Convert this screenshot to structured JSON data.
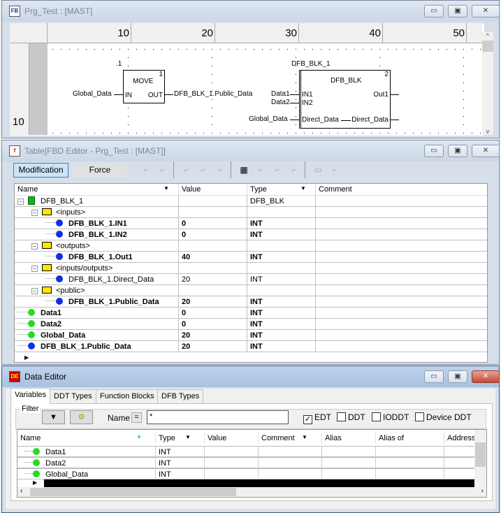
{
  "fbd_window": {
    "title": "Prg_Test : [MAST]",
    "icon": "fbd-icon",
    "ruler": [
      "10",
      "20",
      "30",
      "40",
      "50"
    ],
    "row_number": "10",
    "move_block": {
      "instance": ".1",
      "name": "MOVE",
      "number": "1",
      "in_pin": "IN",
      "out_pin": "OUT",
      "input_var": "Global_Data",
      "output_var": "DFB_BLK_1.Public_Data"
    },
    "dfb_block": {
      "instance": "DFB_BLK_1",
      "name": "DFB_BLK",
      "number": "2",
      "pins_in": [
        "IN1",
        "IN2",
        "Direct_Data"
      ],
      "pins_out": [
        "Out1",
        "Direct_Data"
      ],
      "vars_in": [
        "Data1",
        "Data2",
        "Global_Data"
      ]
    }
  },
  "table_window": {
    "title": "Table[FBD Editor - Prg_Test : [MAST]]",
    "modification_label": "Modification",
    "force_label": "Force",
    "columns": [
      "Name",
      "Value",
      "Type",
      "Comment"
    ],
    "rows": [
      {
        "level": 0,
        "icon": "dfb",
        "expand": "-",
        "name": "DFB_BLK_1",
        "value": "",
        "type": "DFB_BLK",
        "bold": false
      },
      {
        "level": 1,
        "icon": "folder",
        "expand": "-",
        "name": "<inputs>",
        "value": "",
        "type": "",
        "bold": false
      },
      {
        "level": 2,
        "icon": "blue",
        "name": "DFB_BLK_1.IN1",
        "value": "0",
        "type": "INT",
        "bold": true
      },
      {
        "level": 2,
        "icon": "blue",
        "name": "DFB_BLK_1.IN2",
        "value": "0",
        "type": "INT",
        "bold": true
      },
      {
        "level": 1,
        "icon": "folder",
        "expand": "-",
        "name": "<outputs>",
        "value": "",
        "type": "",
        "bold": false
      },
      {
        "level": 2,
        "icon": "blue",
        "name": "DFB_BLK_1.Out1",
        "value": "40",
        "type": "INT",
        "bold": true
      },
      {
        "level": 1,
        "icon": "folder",
        "expand": "-",
        "name": "<inputs/outputs>",
        "value": "",
        "type": "",
        "bold": false
      },
      {
        "level": 2,
        "icon": "blue",
        "name": "DFB_BLK_1.Direct_Data",
        "value": "20",
        "type": "INT",
        "bold": false
      },
      {
        "level": 1,
        "icon": "folder",
        "expand": "-",
        "name": "<public>",
        "value": "",
        "type": "",
        "bold": false
      },
      {
        "level": 2,
        "icon": "blue",
        "name": "DFB_BLK_1.Public_Data",
        "value": "20",
        "type": "INT",
        "bold": true
      },
      {
        "level": 0,
        "icon": "green",
        "name": "Data1",
        "value": "0",
        "type": "INT",
        "bold": true
      },
      {
        "level": 0,
        "icon": "green",
        "name": "Data2",
        "value": "0",
        "type": "INT",
        "bold": true
      },
      {
        "level": 0,
        "icon": "green",
        "name": "Global_Data",
        "value": "20",
        "type": "INT",
        "bold": true
      },
      {
        "level": 0,
        "icon": "blue",
        "name": "DFB_BLK_1.Public_Data",
        "value": "20",
        "type": "INT",
        "bold": true
      }
    ]
  },
  "data_editor": {
    "title": "Data Editor",
    "tabs": [
      "Variables",
      "DDT Types",
      "Function Blocks",
      "DFB Types"
    ],
    "filter": {
      "label": "Filter",
      "name_label": "Name",
      "eq_label": "=",
      "name_value": "*",
      "checkboxes": [
        {
          "label": "EDT",
          "checked": true
        },
        {
          "label": "DDT",
          "checked": false
        },
        {
          "label": "IODDT",
          "checked": false
        },
        {
          "label": "Device DDT",
          "checked": false
        }
      ]
    },
    "columns": [
      "Name",
      "Type",
      "Value",
      "Comment",
      "Alias",
      "Alias of",
      "Address"
    ],
    "rows": [
      {
        "name": "Data1",
        "type": "INT"
      },
      {
        "name": "Data2",
        "type": "INT"
      },
      {
        "name": "Global_Data",
        "type": "INT"
      }
    ]
  },
  "colors": {
    "green_var": "#22dd22",
    "blue_var": "#1030e0",
    "folder": "#ffe600",
    "selected_row": "#000000"
  }
}
